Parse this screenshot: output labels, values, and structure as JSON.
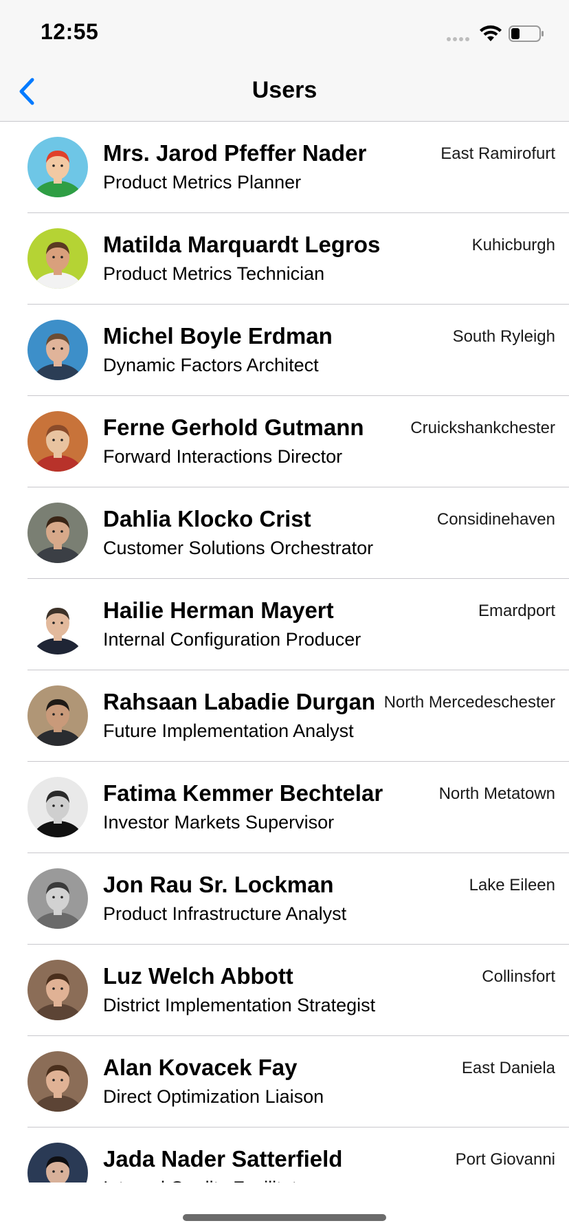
{
  "status_bar": {
    "time": "12:55"
  },
  "nav": {
    "title": "Users",
    "back_icon": "chevron-left-icon"
  },
  "colors": {
    "accent": "#007aff",
    "separator": "#c8c7cc",
    "bar_background": "#f7f7f7"
  },
  "users": [
    {
      "name": "Mrs. Jarod Pfeffer Nader",
      "title": "Product Metrics Planner",
      "city": "East Ramirofurt",
      "avatar_bg": "#6ec6e6",
      "avatar_skin": "#f2c9a3",
      "avatar_hair": "#e0402a",
      "avatar_shirt": "#2f9e44"
    },
    {
      "name": "Matilda Marquardt Legros",
      "title": "Product Metrics Technician",
      "city": "Kuhicburgh",
      "avatar_bg": "#b5d334",
      "avatar_skin": "#d9a07c",
      "avatar_hair": "#5a3a22",
      "avatar_shirt": "#f2f2f2"
    },
    {
      "name": "Michel Boyle Erdman",
      "title": "Dynamic Factors Architect",
      "city": "South Ryleigh",
      "avatar_bg": "#3d8fc9",
      "avatar_skin": "#e0b49a",
      "avatar_hair": "#6b4d33",
      "avatar_shirt": "#2b3d55"
    },
    {
      "name": "Ferne Gerhold Gutmann",
      "title": "Forward Interactions Director",
      "city": "Cruickshankchester",
      "avatar_bg": "#c8733a",
      "avatar_skin": "#e8c3a0",
      "avatar_hair": "#8a4b2a",
      "avatar_shirt": "#b8322a"
    },
    {
      "name": "Dahlia Klocko Crist",
      "title": "Customer Solutions Orchestrator",
      "city": "Considinehaven",
      "avatar_bg": "#7a7f73",
      "avatar_skin": "#d7a98a",
      "avatar_hair": "#3a2516",
      "avatar_shirt": "#3b3f45"
    },
    {
      "name": "Hailie Herman Mayert",
      "title": "Internal Configuration Producer",
      "city": "Emardport",
      "avatar_bg": "#ffffff",
      "avatar_skin": "#e2b99c",
      "avatar_hair": "#3d3228",
      "avatar_shirt": "#1f2535"
    },
    {
      "name": "Rahsaan Labadie Durgan",
      "title": "Future Implementation Analyst",
      "city": "North Mercedeschester",
      "avatar_bg": "#b09676",
      "avatar_skin": "#c99a7a",
      "avatar_hair": "#1f1a16",
      "avatar_shirt": "#2a2c30"
    },
    {
      "name": "Fatima Kemmer Bechtelar",
      "title": "Investor Markets Supervisor",
      "city": "North Metatown",
      "avatar_bg": "#e9e9e9",
      "avatar_skin": "#cfcfcf",
      "avatar_hair": "#2a2a2a",
      "avatar_shirt": "#111111"
    },
    {
      "name": "Jon Rau Sr. Lockman",
      "title": "Product Infrastructure Analyst",
      "city": "Lake Eileen",
      "avatar_bg": "#9a9a9a",
      "avatar_skin": "#d2d2d2",
      "avatar_hair": "#3a3a3a",
      "avatar_shirt": "#6a6a6a"
    },
    {
      "name": "Luz Welch Abbott",
      "title": "District Implementation Strategist",
      "city": "Collinsfort",
      "avatar_bg": "#8b6d57",
      "avatar_skin": "#e0b295",
      "avatar_hair": "#4a2f1c",
      "avatar_shirt": "#5c4435"
    },
    {
      "name": "Alan Kovacek Fay",
      "title": "Direct Optimization Liaison",
      "city": "East Daniela",
      "avatar_bg": "#8b6d57",
      "avatar_skin": "#e0b295",
      "avatar_hair": "#4a2f1c",
      "avatar_shirt": "#5c4435"
    },
    {
      "name": "Jada Nader Satterfield",
      "title": "Internal Quality Facilitator",
      "city": "Port Giovanni",
      "avatar_bg": "#2a3a55",
      "avatar_skin": "#d8b19a",
      "avatar_hair": "#0f0f12",
      "avatar_shirt": "#0f0f12"
    }
  ]
}
